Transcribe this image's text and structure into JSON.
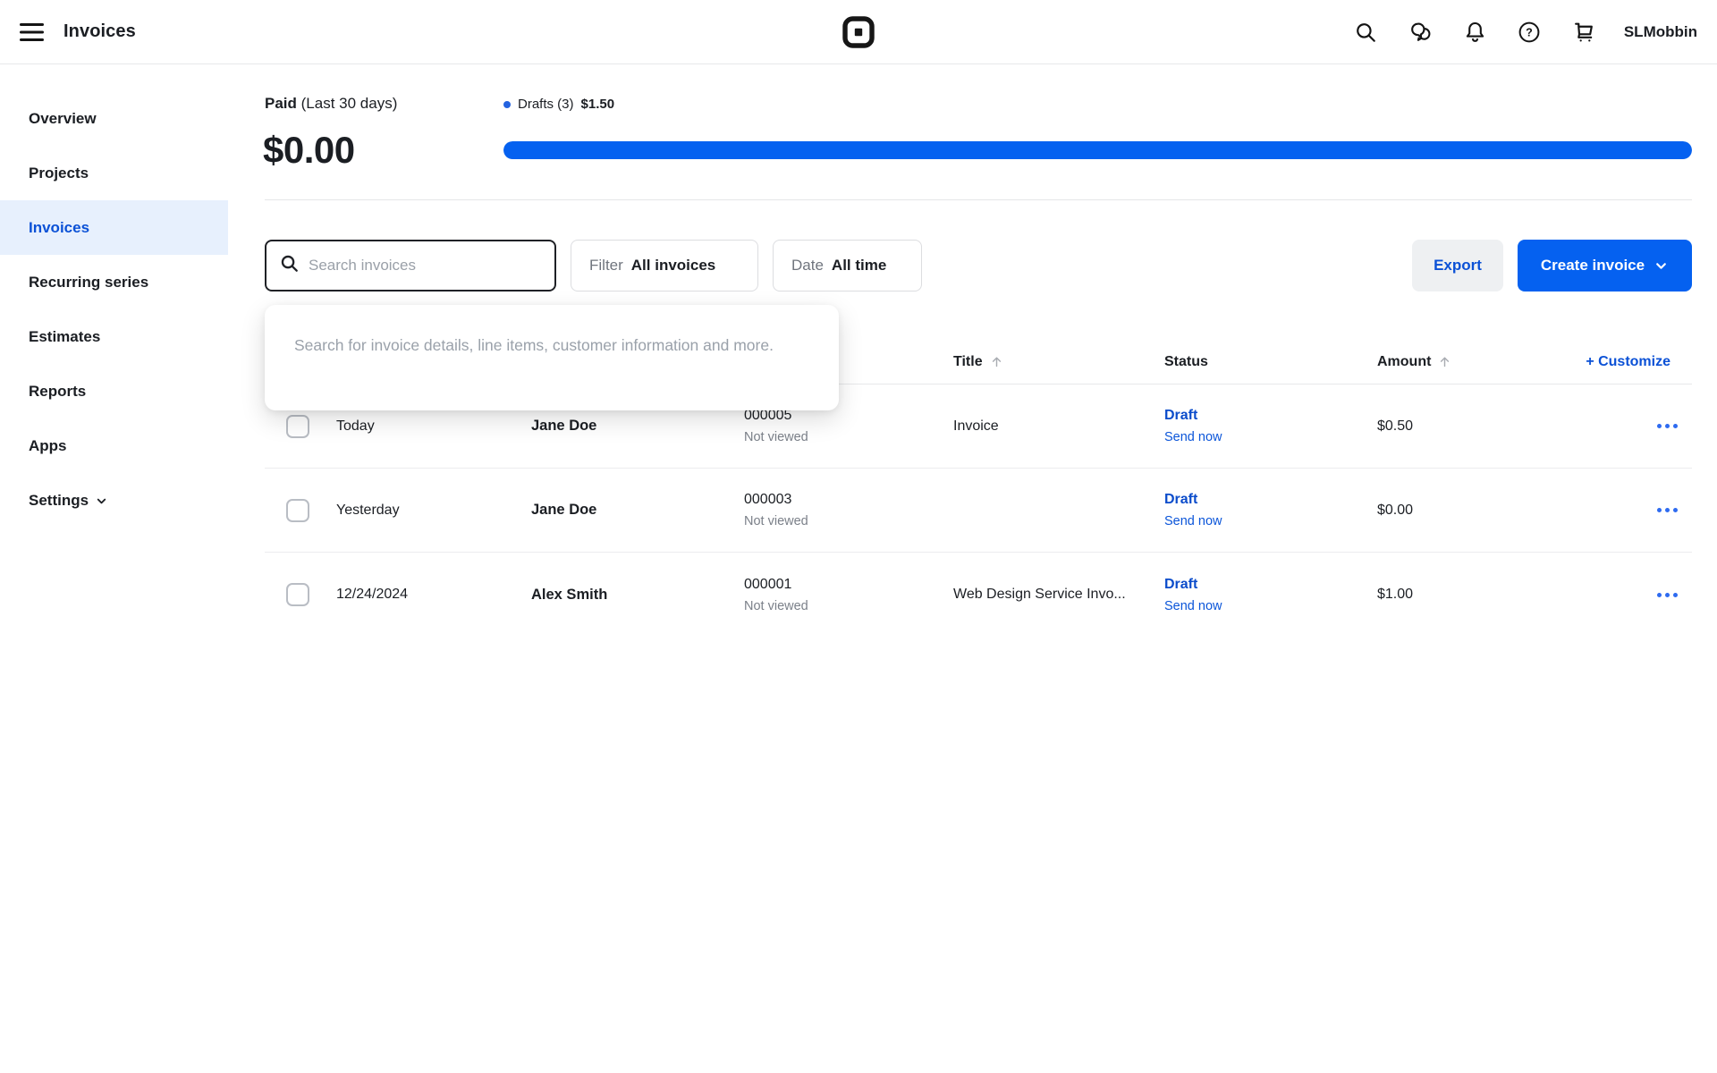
{
  "topbar": {
    "title": "Invoices",
    "user_name": "SLMobbin",
    "icons": {
      "menu": "hamburger",
      "brand": "square-logo",
      "search": "magnifier",
      "messages": "chat-bubbles",
      "notifications": "bell",
      "help": "question-circle",
      "cart": "shopping-cart"
    }
  },
  "sidebar": {
    "items": [
      {
        "label": "Overview",
        "active": false
      },
      {
        "label": "Projects",
        "active": false
      },
      {
        "label": "Invoices",
        "active": true
      },
      {
        "label": "Recurring series",
        "active": false
      },
      {
        "label": "Estimates",
        "active": false
      },
      {
        "label": "Reports",
        "active": false
      },
      {
        "label": "Apps",
        "active": false
      },
      {
        "label": "Settings",
        "active": false,
        "icon": "chevron-down"
      }
    ]
  },
  "summary": {
    "paid_label_bold": "Paid",
    "paid_label_period": "(Last 30 days)",
    "paid_amount": "$0.00",
    "drafts_label": "Drafts (3)",
    "drafts_amount": "$1.50",
    "drafts_progress_percent": 100
  },
  "controls": {
    "search_placeholder": "Search invoices",
    "filter_label": "Filter",
    "filter_value": "All invoices",
    "date_label": "Date",
    "date_value": "All time",
    "export_label": "Export",
    "create_label": "Create invoice"
  },
  "search_dropdown": {
    "hint": "Search for invoice details, line items, customer information and more."
  },
  "table": {
    "headers": {
      "title": "Title",
      "status": "Status",
      "amount": "Amount",
      "customize": "+ Customize"
    },
    "rows": [
      {
        "sent": "Today",
        "customer": "Jane Doe",
        "invoice_number": "000005",
        "viewed": "Not viewed",
        "title": "Invoice",
        "status": "Draft",
        "action": "Send now",
        "amount": "$0.50"
      },
      {
        "sent": "Yesterday",
        "customer": "Jane Doe",
        "invoice_number": "000003",
        "viewed": "Not viewed",
        "title": "",
        "status": "Draft",
        "action": "Send now",
        "amount": "$0.00"
      },
      {
        "sent": "12/24/2024",
        "customer": "Alex Smith",
        "invoice_number": "000001",
        "viewed": "Not viewed",
        "title": "Web Design Service Invo...",
        "status": "Draft",
        "action": "Send now",
        "amount": "$1.00"
      }
    ]
  },
  "colors": {
    "primary_blue": "#0561F0",
    "link_blue": "#0B51D6",
    "draft_blue": "#0B4CCB",
    "active_item_bg": "#E7F0FD",
    "muted_text": "#7B8089",
    "divider": "#E5E6E8",
    "text": "#1B1E23"
  }
}
